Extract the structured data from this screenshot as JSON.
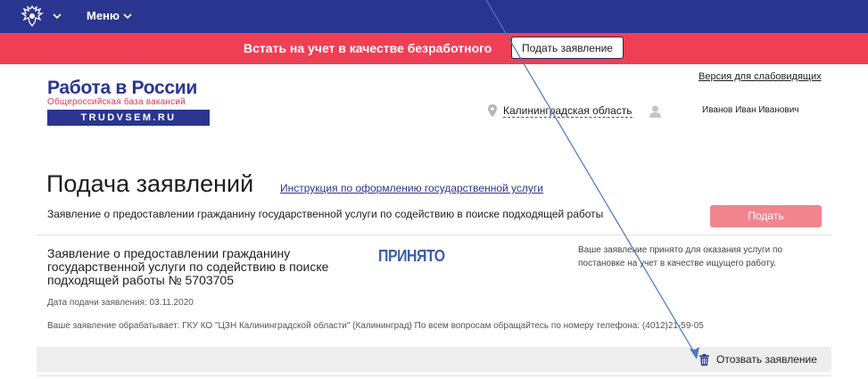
{
  "header": {
    "menu_label": "Меню",
    "banner_text": "Встать на учет в качестве безработного",
    "banner_button": "Подать заявление"
  },
  "logo": {
    "title": "Работа в России",
    "subtitle": "Общероссийская база вакансий",
    "domain": "TRUDVSEM.RU"
  },
  "utility": {
    "low_vision_link": "Версия для слабовидящих",
    "region": "Калининградская область",
    "user_name": "Иванов Иван Иванович"
  },
  "page": {
    "title": "Подача заявлений",
    "instruction_link": "Инструкция по оформлению государственной услуги",
    "subtitle": "Заявление о предоставлении гражданину государственной услуги по содействию в поиске подходящей работы",
    "submit_button": "Подать"
  },
  "application": {
    "title": "Заявление о предоставлении гражданину государственной услуги по содействию в поиске подходящей работы № 5703705",
    "status": "ПРИНЯТО",
    "status_note": "Ваше заявление принято для оказания услуги по постановке на учет в качестве ищущего работу.",
    "date_line": "Дата подачи заявления: 03.11.2020",
    "handler_line": "Ваше заявление обрабатывает: ГКУ КО \"ЦЗН Калининградской области\" (Калининград)  По всем вопросам обращайтесь по номеру телефона: (4012)21-59-05",
    "withdraw_label": "Отозвать заявление"
  },
  "colors": {
    "navy": "#2a3590",
    "banner_red": "#ef3f55",
    "submit_pink": "#f2848f",
    "stamp_blue": "#3a5fa8"
  }
}
